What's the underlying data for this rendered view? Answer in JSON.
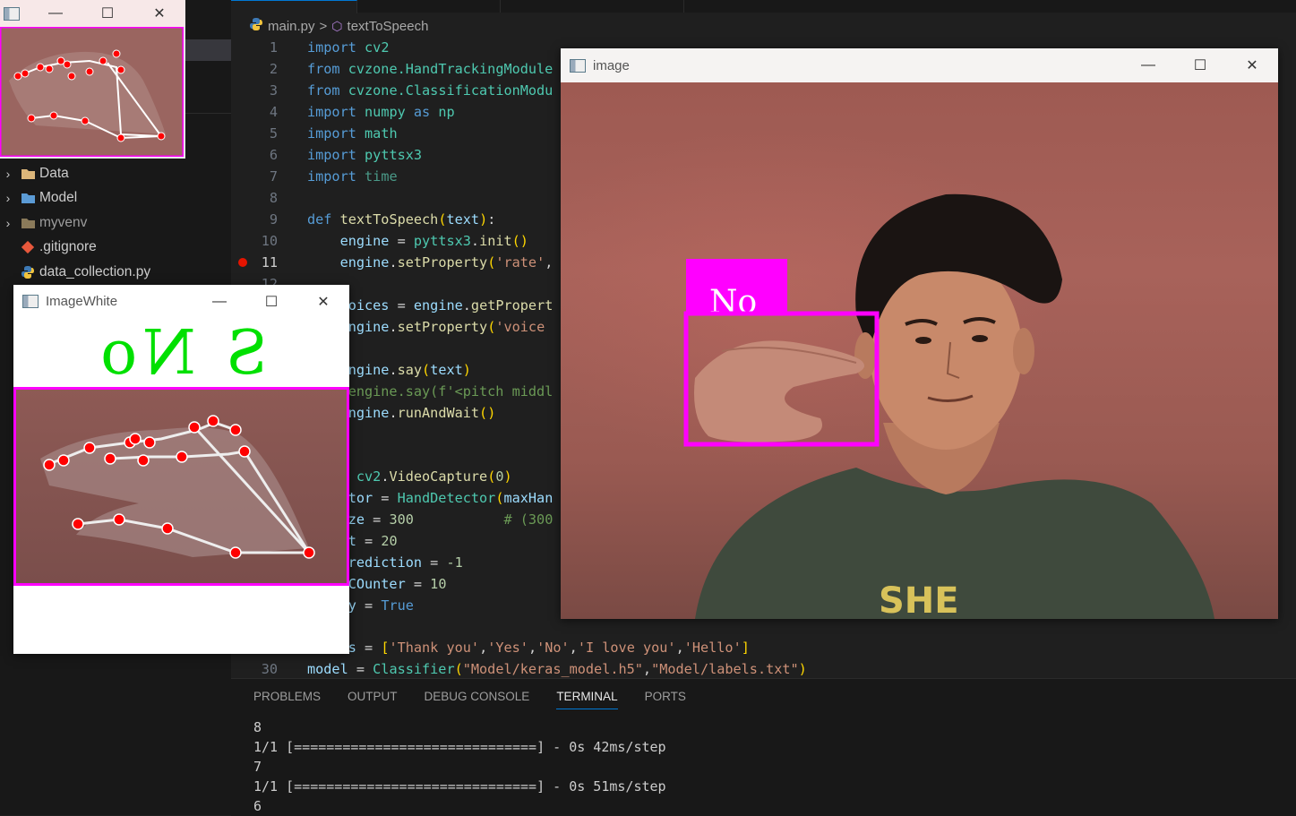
{
  "explorer": {
    "items": [
      {
        "label": "Data",
        "type": "folder",
        "color": "#dcb67a"
      },
      {
        "label": "Model",
        "type": "folder",
        "color": "#5b9bd5"
      },
      {
        "label": "myvenv",
        "type": "folder",
        "color": "#8a7a5a"
      },
      {
        "label": ".gitignore",
        "type": "file",
        "icon": "git-icon"
      },
      {
        "label": "data_collection.py",
        "type": "file",
        "icon": "python-icon"
      }
    ]
  },
  "breadcrumb": {
    "file": "main.py",
    "separator": ">",
    "symbol": "textToSpeech"
  },
  "code": {
    "line_numbers": [
      "1",
      "2",
      "3",
      "4",
      "5",
      "6",
      "7",
      "8",
      "9",
      "10",
      "11",
      "12",
      "30"
    ],
    "current_line": "11",
    "breakpoint_line": "11"
  },
  "panel": {
    "tabs": [
      "PROBLEMS",
      "OUTPUT",
      "DEBUG CONSOLE",
      "TERMINAL",
      "PORTS"
    ],
    "active_tab": "TERMINAL",
    "terminal_lines": [
      "8",
      "1/1 [==============================] - 0s 42ms/step",
      "7",
      "1/1 [==============================] - 0s 51ms/step",
      "6"
    ]
  },
  "windows": {
    "image_white": {
      "title": "ImageWhite",
      "mirrored_text": "S No",
      "text_color": "#00e000",
      "box_color": "#ff00ff",
      "landmark_color": "#ff0000"
    },
    "image": {
      "title": "image",
      "label": "No",
      "label_bg": "#ff00ff",
      "box_color": "#ff00ff",
      "shirt_text": "SHE"
    },
    "controls": {
      "minimize": "—",
      "maximize": "☐",
      "close": "✕"
    }
  }
}
